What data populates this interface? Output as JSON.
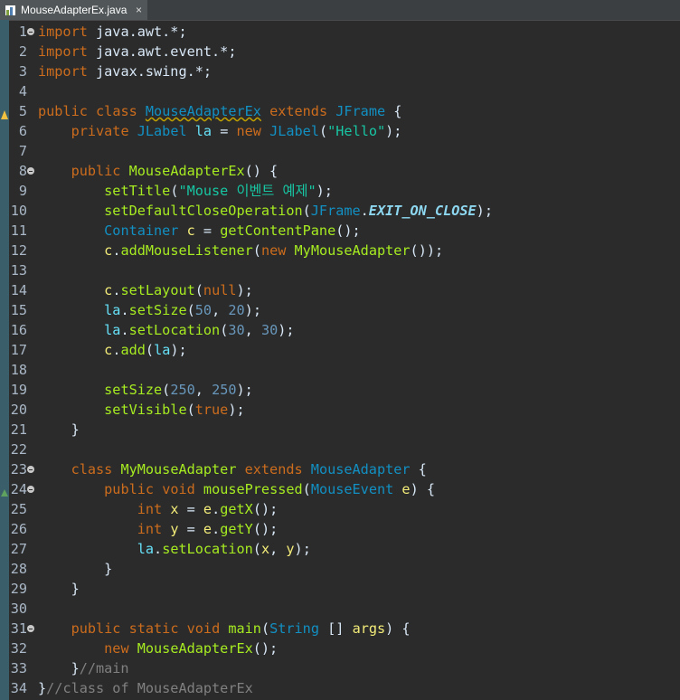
{
  "tab": {
    "file_name": "MouseAdapterEx.java",
    "close_glyph": "×"
  },
  "editor": {
    "line_numbers": [
      "1",
      "2",
      "3",
      "4",
      "5",
      "6",
      "7",
      "8",
      "9",
      "10",
      "11",
      "12",
      "13",
      "14",
      "15",
      "16",
      "17",
      "18",
      "19",
      "20",
      "21",
      "22",
      "23",
      "24",
      "25",
      "26",
      "27",
      "28",
      "29",
      "30",
      "31",
      "32",
      "33",
      "34"
    ],
    "code": {
      "l1": [
        "import",
        " java.awt.*;"
      ],
      "l2": [
        "import",
        " java.awt.event.*;"
      ],
      "l3": [
        "import",
        " javax.swing.*;"
      ],
      "l5": [
        "public",
        " ",
        "class",
        " ",
        "MouseAdapterEx",
        " ",
        "extends",
        " ",
        "JFrame",
        " {"
      ],
      "l6": [
        "    ",
        "private",
        " ",
        "JLabel",
        " ",
        "la",
        " = ",
        "new",
        " ",
        "JLabel",
        "(",
        "\"Hello\"",
        ");"
      ],
      "l8": [
        "    ",
        "public",
        " ",
        "MouseAdapterEx",
        "() {"
      ],
      "l9": [
        "        ",
        "setTitle",
        "(",
        "\"Mouse 이벤트 예제\"",
        ");"
      ],
      "l10": [
        "        ",
        "setDefaultCloseOperation",
        "(",
        "JFrame",
        ".",
        "EXIT_ON_CLOSE",
        ");"
      ],
      "l11": [
        "        ",
        "Container",
        " ",
        "c",
        " = ",
        "getContentPane",
        "();"
      ],
      "l12": [
        "        ",
        "c",
        ".",
        "addMouseListener",
        "(",
        "new",
        " ",
        "MyMouseAdapter",
        "());"
      ],
      "l14": [
        "        ",
        "c",
        ".",
        "setLayout",
        "(",
        "null",
        ");"
      ],
      "l15": [
        "        ",
        "la",
        ".",
        "setSize",
        "(",
        "50",
        ", ",
        "20",
        ");"
      ],
      "l16": [
        "        ",
        "la",
        ".",
        "setLocation",
        "(",
        "30",
        ", ",
        "30",
        ");"
      ],
      "l17": [
        "        ",
        "c",
        ".",
        "add",
        "(",
        "la",
        ");"
      ],
      "l19": [
        "        ",
        "setSize",
        "(",
        "250",
        ", ",
        "250",
        ");"
      ],
      "l20": [
        "        ",
        "setVisible",
        "(",
        "true",
        ");"
      ],
      "l21": [
        "    }"
      ],
      "l23": [
        "    ",
        "class",
        " ",
        "MyMouseAdapter",
        " ",
        "extends",
        " ",
        "MouseAdapter",
        " {"
      ],
      "l24": [
        "        ",
        "public",
        " ",
        "void",
        " ",
        "mousePressed",
        "(",
        "MouseEvent",
        " ",
        "e",
        ") {"
      ],
      "l25": [
        "            ",
        "int",
        " ",
        "x",
        " = ",
        "e",
        ".",
        "getX",
        "();"
      ],
      "l26": [
        "            ",
        "int",
        " ",
        "y",
        " = ",
        "e",
        ".",
        "getY",
        "();"
      ],
      "l27": [
        "            ",
        "la",
        ".",
        "setLocation",
        "(",
        "x",
        ", ",
        "y",
        ");"
      ],
      "l28": [
        "        }"
      ],
      "l29": [
        "    }"
      ],
      "l31": [
        "    ",
        "public",
        " ",
        "static",
        " ",
        "void",
        " ",
        "main",
        "(",
        "String",
        " [] ",
        "args",
        ") {"
      ],
      "l32": [
        "        ",
        "new",
        " ",
        "MouseAdapterEx",
        "();"
      ],
      "l33": [
        "    }",
        "//main"
      ],
      "l34": [
        "}",
        "//class of MouseAdapterEx"
      ]
    }
  },
  "colors": {
    "background": "#2b2b2b",
    "keyword": "#cc6c1d",
    "type": "#1290c3",
    "string": "#17c6a3",
    "number": "#6897bb",
    "field": "#66e1f8",
    "method": "#a7ec21",
    "comment": "#808080"
  }
}
